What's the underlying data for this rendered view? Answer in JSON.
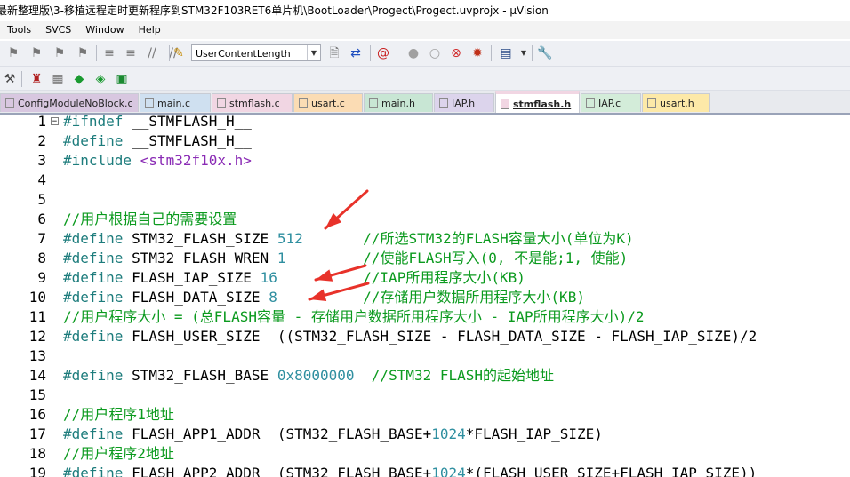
{
  "window": {
    "title": "最新整理版\\3-移植远程定时更新程序到STM32F103RET6单片机\\BootLoader\\Progect\\Progect.uvprojx - µVision"
  },
  "menu": [
    "Tools",
    "SVCS",
    "Window",
    "Help"
  ],
  "toolbar": {
    "target_combo_value": "UserContentLength"
  },
  "tabs": [
    {
      "label": "ConfigModuleNoBlock.c",
      "color": "#d8c7e0"
    },
    {
      "label": "main.c",
      "color": "#cfe0f0"
    },
    {
      "label": "stmflash.c",
      "color": "#f1d6e3"
    },
    {
      "label": "usart.c",
      "color": "#fbdcb4"
    },
    {
      "label": "main.h",
      "color": "#c8e6d4"
    },
    {
      "label": "IAP.h",
      "color": "#dcd4ec"
    },
    {
      "label": "stmflash.h",
      "color": "#f1d6e3",
      "active": true
    },
    {
      "label": "IAP.c",
      "color": "#d3ecd9"
    },
    {
      "label": "usart.h",
      "color": "#fde9a8"
    }
  ],
  "code": [
    {
      "n": "1",
      "fold": "⊟",
      "t": [
        [
          "pp",
          "#ifndef "
        ],
        [
          "id",
          "__STMFLASH_H__"
        ]
      ]
    },
    {
      "n": "2",
      "t": [
        [
          "pp",
          "#define "
        ],
        [
          "id",
          "__STMFLASH_H__"
        ]
      ]
    },
    {
      "n": "3",
      "t": [
        [
          "pp",
          "#include "
        ],
        [
          "inc",
          "<stm32f10x.h>"
        ]
      ]
    },
    {
      "n": "4",
      "t": []
    },
    {
      "n": "5",
      "t": []
    },
    {
      "n": "6",
      "t": [
        [
          "cm",
          "//用户根据自己的需要设置"
        ]
      ]
    },
    {
      "n": "7",
      "t": [
        [
          "pp",
          "#define "
        ],
        [
          "id",
          "STM32_FLASH_SIZE "
        ],
        [
          "num",
          "512"
        ],
        [
          "id",
          "       "
        ],
        [
          "cm",
          "//所选STM32的FLASH容量大小(单位为K)"
        ]
      ]
    },
    {
      "n": "8",
      "t": [
        [
          "pp",
          "#define "
        ],
        [
          "id",
          "STM32_FLASH_WREN "
        ],
        [
          "num",
          "1"
        ],
        [
          "id",
          "         "
        ],
        [
          "cm",
          "//使能FLASH写入(0, 不是能;1, 使能)"
        ]
      ]
    },
    {
      "n": "9",
      "t": [
        [
          "pp",
          "#define "
        ],
        [
          "id",
          "FLASH_IAP_SIZE "
        ],
        [
          "num",
          "16"
        ],
        [
          "id",
          "          "
        ],
        [
          "cm",
          "//IAP所用程序大小(KB)"
        ]
      ]
    },
    {
      "n": "10",
      "t": [
        [
          "pp",
          "#define "
        ],
        [
          "id",
          "FLASH_DATA_SIZE "
        ],
        [
          "num",
          "8"
        ],
        [
          "id",
          "          "
        ],
        [
          "cm",
          "//存储用户数据所用程序大小(KB)"
        ]
      ]
    },
    {
      "n": "11",
      "t": [
        [
          "cm",
          "//用户程序大小 = (总FLASH容量 - 存储用户数据所用程序大小 - IAP所用程序大小)/2"
        ]
      ]
    },
    {
      "n": "12",
      "t": [
        [
          "pp",
          "#define "
        ],
        [
          "id",
          "FLASH_USER_SIZE  ((STM32_FLASH_SIZE - FLASH_DATA_SIZE - FLASH_IAP_SIZE)/2"
        ]
      ]
    },
    {
      "n": "13",
      "t": []
    },
    {
      "n": "14",
      "t": [
        [
          "pp",
          "#define "
        ],
        [
          "id",
          "STM32_FLASH_BASE "
        ],
        [
          "num",
          "0x8000000"
        ],
        [
          "id",
          "  "
        ],
        [
          "cm",
          "//STM32 FLASH的起始地址"
        ]
      ]
    },
    {
      "n": "15",
      "t": []
    },
    {
      "n": "16",
      "t": [
        [
          "cm",
          "//用户程序1地址"
        ]
      ]
    },
    {
      "n": "17",
      "t": [
        [
          "pp",
          "#define "
        ],
        [
          "id",
          "FLASH_APP1_ADDR  (STM32_FLASH_BASE+"
        ],
        [
          "num",
          "1024"
        ],
        [
          "id",
          "*FLASH_IAP_SIZE)"
        ]
      ]
    },
    {
      "n": "18",
      "t": [
        [
          "cm",
          "//用户程序2地址"
        ]
      ]
    },
    {
      "n": "19",
      "t": [
        [
          "pp",
          "#define "
        ],
        [
          "id",
          "FLASH_APP2_ADDR  (STM32_FLASH_BASE+"
        ],
        [
          "num",
          "1024"
        ],
        [
          "id",
          "*(FLASH_USER_SIZE+FLASH_IAP_SIZE))"
        ]
      ]
    }
  ],
  "annotation_color": "#e8322a"
}
